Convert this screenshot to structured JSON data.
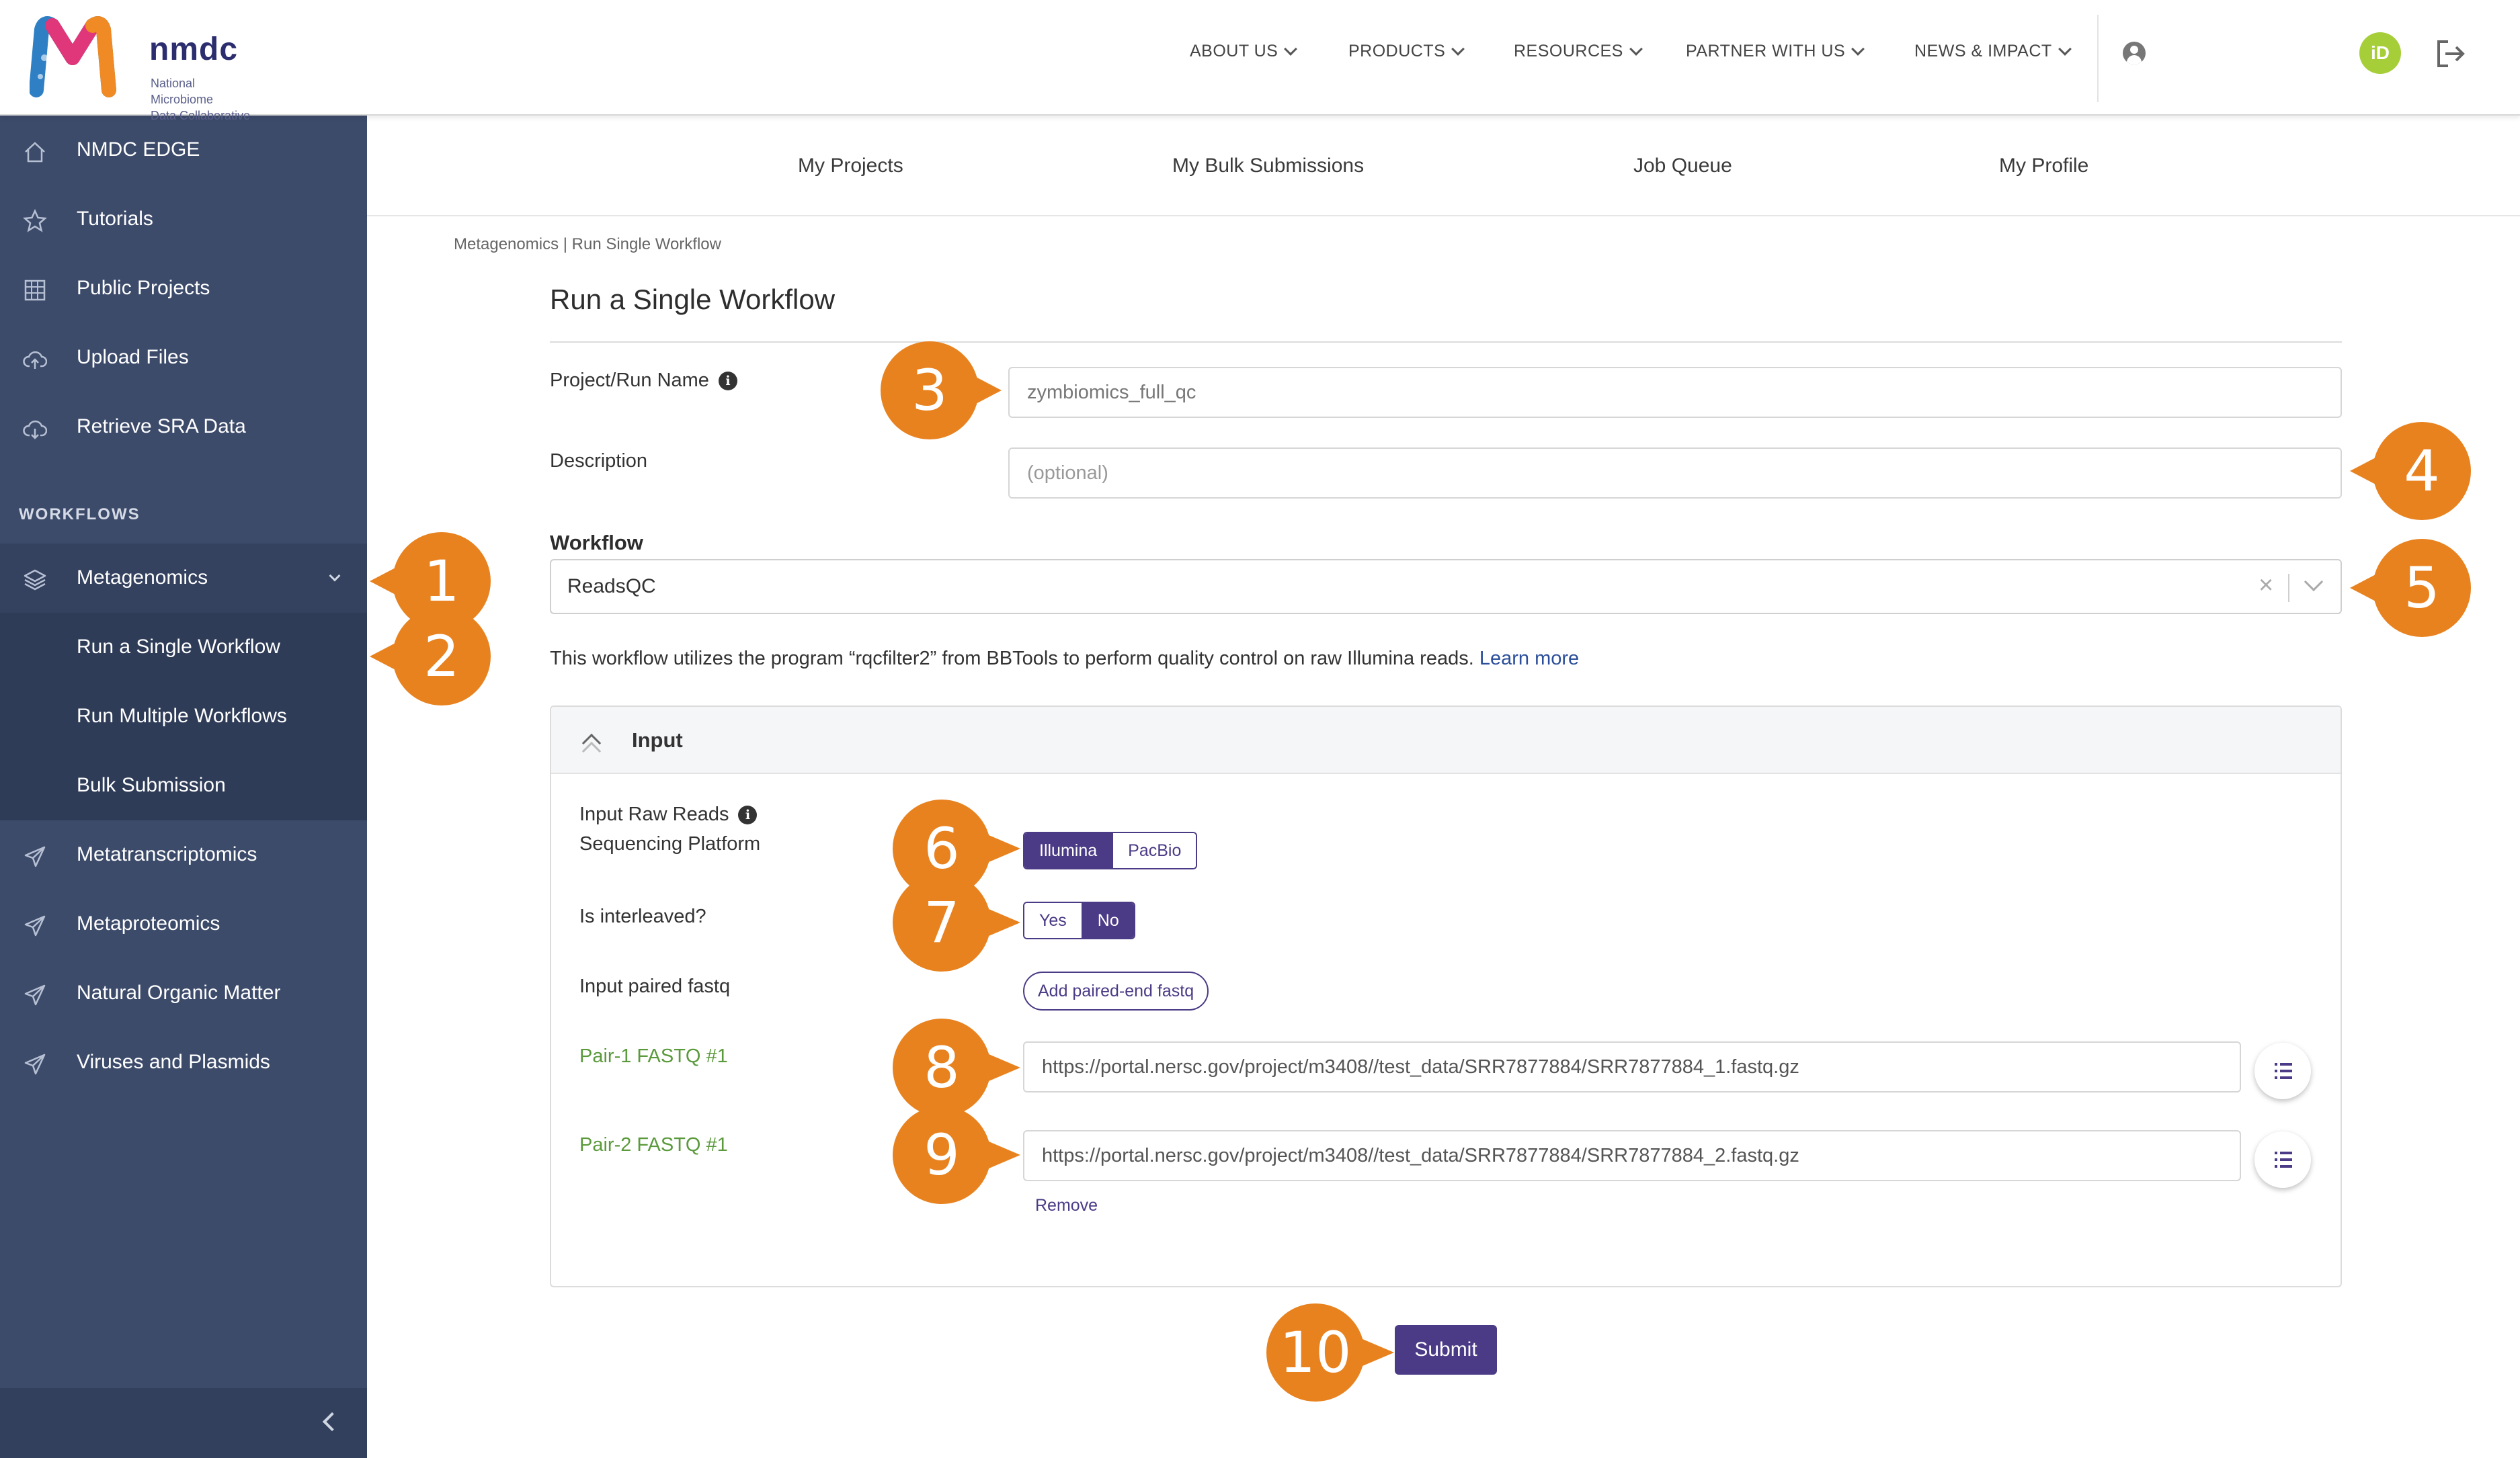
{
  "header": {
    "logo_word": "nmdc",
    "logo_sub_line1": "National Microbiome",
    "logo_sub_line2": "Data Collaborative",
    "nav": [
      "ABOUT US",
      "PRODUCTS",
      "RESOURCES",
      "PARTNER WITH US",
      "NEWS & IMPACT"
    ],
    "orcid": "iD"
  },
  "sidebar": {
    "items": [
      "NMDC EDGE",
      "Tutorials",
      "Public Projects",
      "Upload Files",
      "Retrieve SRA Data"
    ],
    "section": "WORKFLOWS",
    "metagenomics": "Metagenomics",
    "sub_items": [
      "Run a Single Workflow",
      "Run Multiple Workflows",
      "Bulk Submission"
    ],
    "workflows": [
      "Metatranscriptomics",
      "Metaproteomics",
      "Natural Organic Matter",
      "Viruses and Plasmids"
    ]
  },
  "subnav": [
    "My Projects",
    "My Bulk Submissions",
    "Job Queue",
    "My Profile"
  ],
  "breadcrumb": "Metagenomics | Run Single Workflow",
  "page_title": "Run a Single Workflow",
  "form": {
    "project_label": "Project/Run Name",
    "project_value": "zymbiomics_full_qc",
    "description_label": "Description",
    "description_placeholder": "(optional)",
    "workflow_label": "Workflow",
    "workflow_value": "ReadsQC",
    "workflow_desc": "This workflow utilizes the program “rqcfilter2” from BBTools to perform quality control on raw Illumina reads.",
    "learn_more": "Learn more"
  },
  "input_panel": {
    "title": "Input",
    "platform_label_1": "Input Raw Reads",
    "platform_label_2": "Sequencing Platform",
    "platform_options": [
      "Illumina",
      "PacBio"
    ],
    "interleaved_label": "Is interleaved?",
    "interleaved_options": [
      "Yes",
      "No"
    ],
    "paired_label": "Input paired fastq",
    "add_paired": "Add paired-end fastq",
    "pair1_label": "Pair-1 FASTQ #1",
    "pair1_value": "https://portal.nersc.gov/project/m3408//test_data/SRR7877884/SRR7877884_1.fastq.gz",
    "pair2_label": "Pair-2 FASTQ #1",
    "pair2_value": "https://portal.nersc.gov/project/m3408//test_data/SRR7877884/SRR7877884_2.fastq.gz",
    "remove": "Remove"
  },
  "submit": "Submit",
  "callouts": [
    "1",
    "2",
    "3",
    "4",
    "5",
    "6",
    "7",
    "8",
    "9",
    "10"
  ],
  "colors": {
    "sidebar": "#3d4b6b",
    "accent": "#4b3a85",
    "callout": "#e8821f",
    "green_label": "#5b9a3c"
  }
}
